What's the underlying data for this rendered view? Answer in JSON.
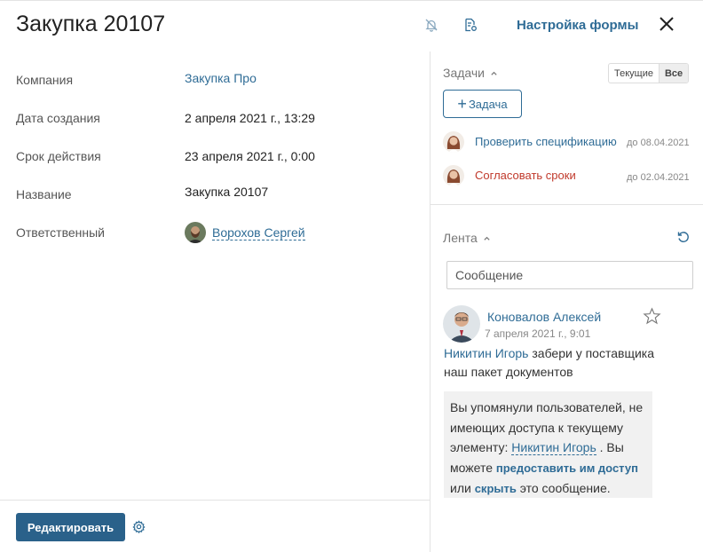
{
  "header": {
    "title": "Закупка 20107",
    "form_settings_label": "Настройка формы",
    "icons": [
      "bell-off-icon",
      "document-settings-icon",
      "close-icon"
    ]
  },
  "fields": [
    {
      "label": "Компания",
      "value": "Закупка Про"
    },
    {
      "label": "Дата создания",
      "value": "2 апреля 2021 г., 13:29"
    },
    {
      "label": "Срок действия",
      "value": "23 апреля 2021 г., 0:00"
    },
    {
      "label": "Название",
      "value": "Закупка 20107"
    },
    {
      "label": "Ответственный",
      "value": "Ворохов Сергей"
    }
  ],
  "footer": {
    "edit_label": "Редактировать"
  },
  "tasks": {
    "title": "Задачи",
    "filter_options": [
      "Текущие",
      "Все"
    ],
    "filter_selected": "Все",
    "add_label": "Задача",
    "items": [
      {
        "title": "Проверить спецификацию",
        "due": "до 08.04.2021",
        "color": "#2f6c96"
      },
      {
        "title": "Согласовать сроки",
        "due": "до 02.04.2021",
        "color": "#c0392b"
      }
    ]
  },
  "feed": {
    "title": "Лента",
    "message_placeholder": "Сообщение",
    "post": {
      "author": "Коновалов Алексей",
      "date": "7 апреля 2021 г., 9:01",
      "mention": "Никитин Игорь",
      "text": " забери у поставщика наш пакет документов",
      "notice": {
        "part1": "Вы упомянули пользователей, не имеющих доступа к текущему элементу: ",
        "user": "Никитин Игорь",
        "part2": " . Вы можете ",
        "grant_link": "предоставить им доступ",
        "part3": " или ",
        "hide_link": "скрыть",
        "part4": " это сообщение."
      }
    }
  },
  "colors": {
    "accent": "#2f6c96",
    "button": "#2a618a",
    "danger": "#c0392b"
  }
}
